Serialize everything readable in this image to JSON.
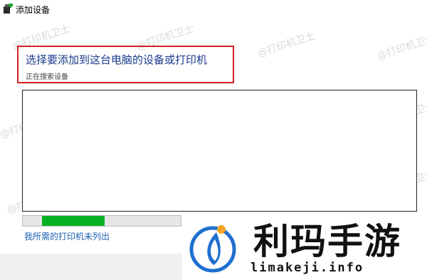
{
  "window": {
    "title": "添加设备"
  },
  "header": {
    "title": "选择要添加到这台电脑的设备或打印机",
    "status": "正在搜索设备"
  },
  "device_list": {
    "items": []
  },
  "progress": {
    "fraction": 0.4,
    "color": "#06b025"
  },
  "link": {
    "label": "我所需的打印机未列出"
  },
  "watermark": {
    "text": "@打印机卫士"
  },
  "logo": {
    "name_cn": "利玛手游",
    "domain": "limakeji.info"
  },
  "colors": {
    "highlight_border": "#d42020",
    "title_text": "#1a3a8c",
    "link": "#1a5fb4",
    "logo_blue": "#1e6fd0",
    "logo_orange": "#f5a623"
  }
}
